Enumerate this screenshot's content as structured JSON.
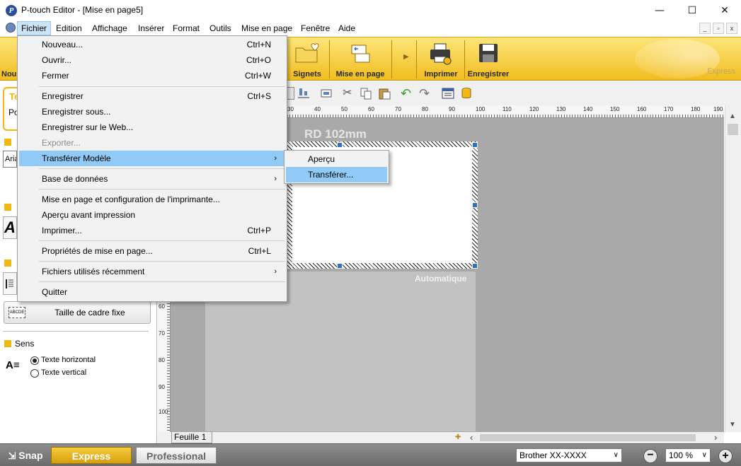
{
  "window": {
    "title": "P-touch Editor - [Mise en page5]",
    "controls": {
      "minimize": "—",
      "maximize": "☐",
      "close": "✕"
    }
  },
  "menubar": {
    "items": [
      "Fichier",
      "Edition",
      "Affichage",
      "Insérer",
      "Format",
      "Outils",
      "Mise en page",
      "Fenêtre",
      "Aide"
    ],
    "active": "Fichier"
  },
  "ribbon": {
    "partial_left": "Nou",
    "buttons": [
      {
        "label": "Signets",
        "icon": "folder-heart-icon"
      },
      {
        "label": "Mise en page",
        "icon": "layout-icon"
      },
      {
        "label": "Imprimer",
        "icon": "printer-icon"
      },
      {
        "label": "Enregistrer",
        "icon": "floppy-disk-icon"
      }
    ],
    "mode_label": "Express"
  },
  "left_panel": {
    "partial_title": "Te",
    "partial_sub": "Po",
    "font_partial": "Aria",
    "fixed_frame_button": "Taille de cadre fixe",
    "direction": {
      "title": "Sens",
      "options": [
        "Texte horizontal",
        "Texte vertical"
      ],
      "selected": "Texte horizontal"
    }
  },
  "canvas": {
    "label_title": "RD 102mm",
    "auto_text": "Automatique",
    "ruler_h": [
      "30",
      "40",
      "50",
      "60",
      "70",
      "80",
      "90",
      "100",
      "110",
      "120",
      "130",
      "140",
      "150",
      "160",
      "170",
      "180",
      "190"
    ],
    "ruler_v": [
      "60",
      "70",
      "80",
      "90",
      "100"
    ],
    "sheet_tab": "Feuille 1"
  },
  "file_menu": {
    "items": [
      {
        "label": "Nouveau...",
        "shortcut": "Ctrl+N"
      },
      {
        "label": "Ouvrir...",
        "shortcut": "Ctrl+O"
      },
      {
        "label": "Fermer",
        "shortcut": "Ctrl+W"
      },
      {
        "label": "Enregistrer",
        "shortcut": "Ctrl+S"
      },
      {
        "label": "Enregistrer sous...",
        "shortcut": ""
      },
      {
        "label": "Enregistrer sur le Web...",
        "shortcut": ""
      },
      {
        "label": "Exporter...",
        "shortcut": ""
      },
      {
        "label": "Transférer Modèle",
        "shortcut": ""
      },
      {
        "label": "Base de données",
        "shortcut": ""
      },
      {
        "label": "Mise en page et configuration de l'imprimante...",
        "shortcut": ""
      },
      {
        "label": "Aperçu avant impression",
        "shortcut": ""
      },
      {
        "label": "Imprimer...",
        "shortcut": "Ctrl+P"
      },
      {
        "label": "Propriétés de mise en page...",
        "shortcut": "Ctrl+L"
      },
      {
        "label": "Fichiers utilisés récemment",
        "shortcut": ""
      },
      {
        "label": "Quitter",
        "shortcut": ""
      }
    ],
    "submenu_arrow": "›"
  },
  "submenu": {
    "items": [
      "Aperçu",
      "Transférer..."
    ],
    "highlighted": "Transférer..."
  },
  "statusbar": {
    "snap": "Snap",
    "express": "Express",
    "professional": "Professional",
    "printer": "Brother  XX-XXXX",
    "zoom": "100 %"
  },
  "colors": {
    "ribbon": "#f1bd1e",
    "menu_highlight": "#91c9f7",
    "express_button": "#e2a810"
  }
}
